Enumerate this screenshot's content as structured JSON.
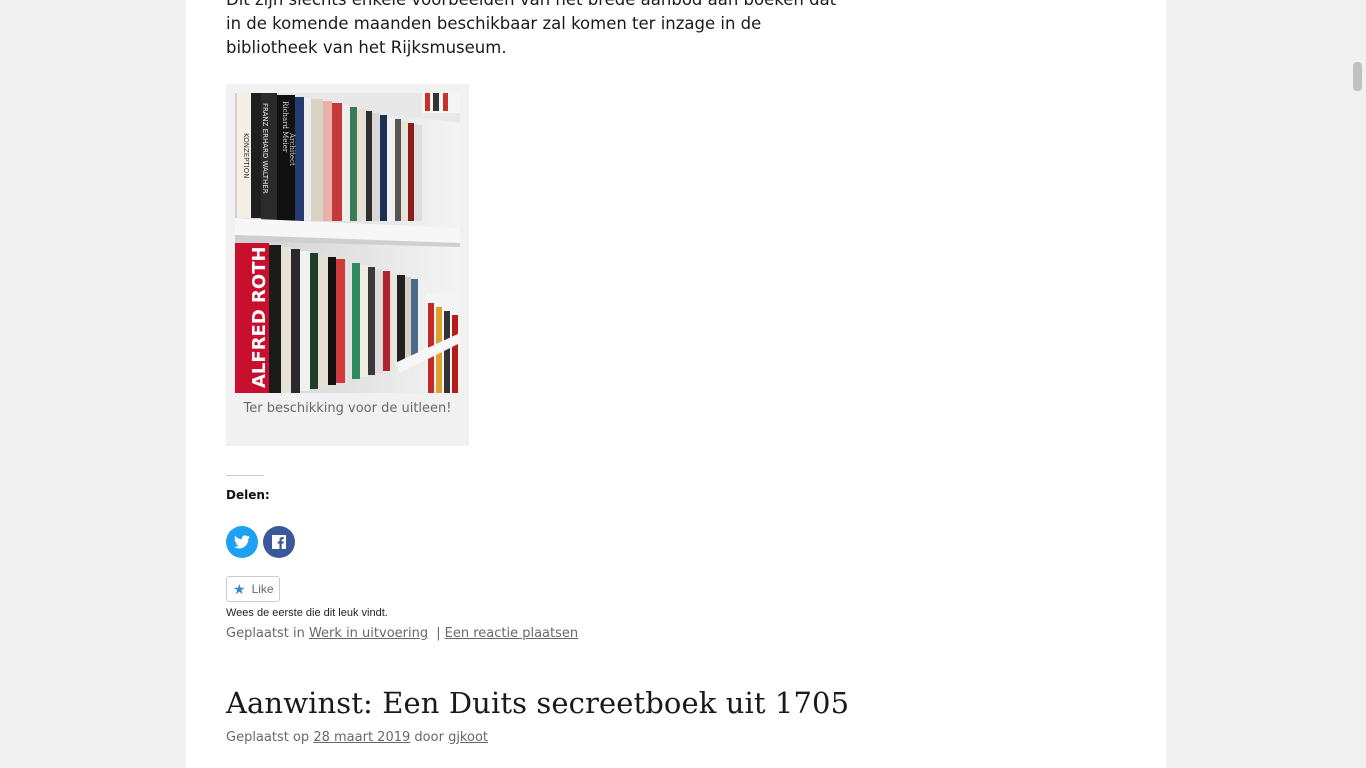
{
  "article": {
    "intro_text": "Dit zijn slechts enkele voorbeelden van het brede aanbod aan boeken dat in de komende maanden beschikbaar zal komen ter inzage in de bibliotheek van het Rijksmuseum.",
    "figure": {
      "image_alt": "Boekenkast met kunstboeken",
      "spine_texts": [
        "KONZEPTION",
        "FRANZ ERHARD WALTHER",
        "Richard Meier",
        "Architect",
        "ALFRED ROTH"
      ],
      "caption": "Ter beschikking voor de uitleen!"
    }
  },
  "share": {
    "heading": "Delen:",
    "twitter_icon": "twitter-icon",
    "facebook_icon": "facebook-icon",
    "twitter_color": "#1da1f2",
    "facebook_color": "#3b5998"
  },
  "like": {
    "button_label": "Like",
    "icon": "star-icon",
    "text": "Wees de eerste die dit leuk vindt."
  },
  "post_meta": {
    "posted_in_prefix": "Geplaatst in",
    "category": "Werk in uitvoering",
    "separator": "|",
    "comment_link": "Een reactie plaatsen"
  },
  "next_post": {
    "title": "Aanwinst: Een Duits secreetboek uit 1705",
    "posted_on_prefix": "Geplaatst op",
    "date": "28 maart 2019",
    "by_word": "door",
    "author": "gjkoot"
  }
}
